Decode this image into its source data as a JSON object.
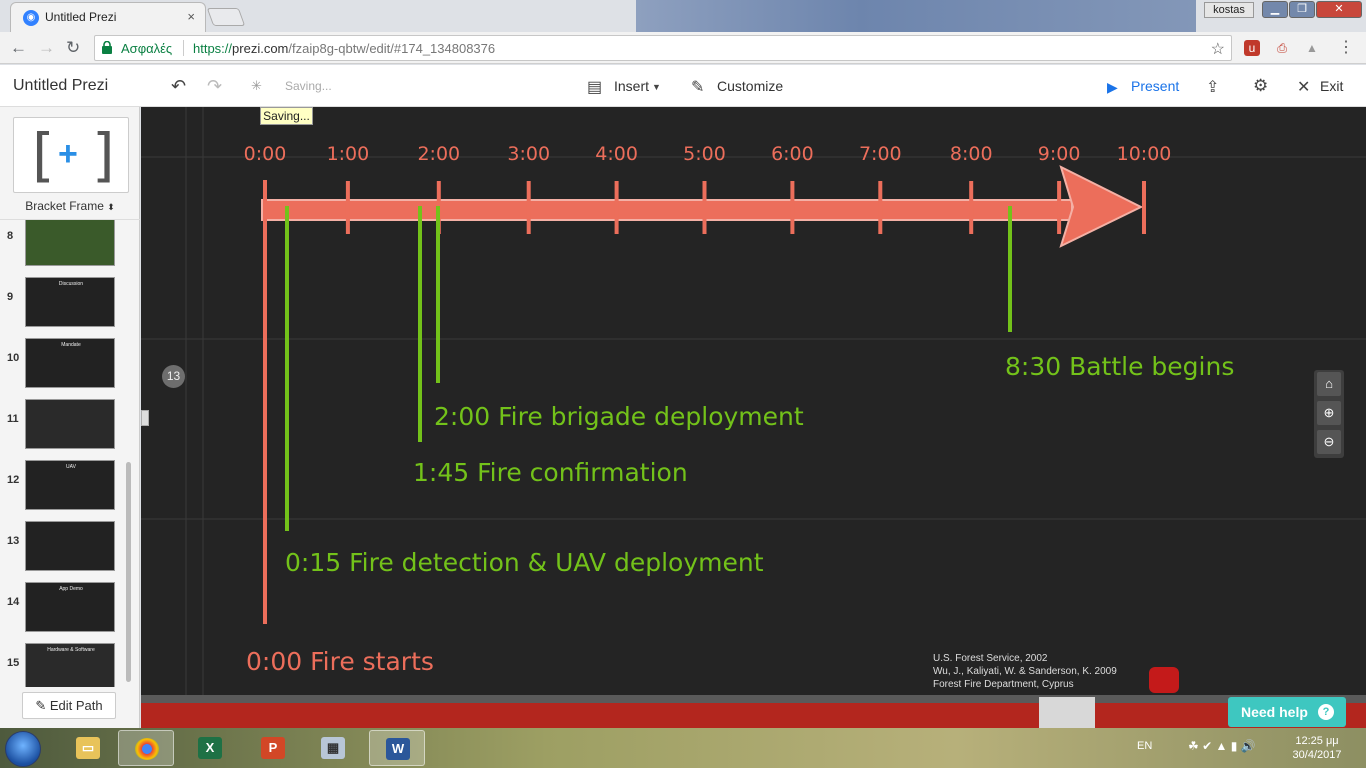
{
  "browser": {
    "tab_title": "Untitled Prezi",
    "tab_close": "×",
    "user_name": "kostas",
    "secure_label": "Ασφαλές",
    "url_proto": "https://",
    "url_host": "prezi.com",
    "url_path": "/fzaip8g-qbtw/edit/#174_134808376"
  },
  "toolbar": {
    "title": "Untitled Prezi",
    "saving": "Saving...",
    "insert": "Insert",
    "customize": "Customize",
    "present": "Present",
    "exit": "Exit"
  },
  "saving_tooltip": "Saving...",
  "sidebar": {
    "frame_type": "Bracket Frame",
    "edit_path": "Edit Path",
    "slides": [
      {
        "num": "8",
        "title": ""
      },
      {
        "num": "9",
        "title": "Discussion"
      },
      {
        "num": "10",
        "title": "Mandate"
      },
      {
        "num": "11",
        "title": ""
      },
      {
        "num": "12",
        "title": "UAV"
      },
      {
        "num": "13",
        "title": ""
      },
      {
        "num": "14",
        "title": "App Demo"
      },
      {
        "num": "15",
        "title": "Hardware & Software"
      }
    ]
  },
  "step_badge": "13",
  "timeline": {
    "ticks": [
      "0:00",
      "1:00",
      "2:00",
      "3:00",
      "4:00",
      "5:00",
      "6:00",
      "7:00",
      "8:00",
      "9:00",
      "10:00"
    ],
    "events": [
      {
        "label": "0:00 Fire starts",
        "color": "#ec6e5b"
      },
      {
        "label": "0:15 Fire detection & UAV deployment",
        "color": "#73c21a"
      },
      {
        "label": "1:45 Fire confirmation",
        "color": "#73c21a"
      },
      {
        "label": "2:00 Fire brigade deployment",
        "color": "#73c21a"
      },
      {
        "label": "8:30 Battle begins",
        "color": "#73c21a"
      }
    ],
    "credits": [
      "U.S. Forest Service, 2002",
      "Wu, J., Kaliyati, W. & Sanderson, K. 2009",
      "Forest Fire Department, Cyprus"
    ]
  },
  "help": {
    "label": "Need help",
    "icon": "?"
  },
  "taskbar": {
    "lang": "EN",
    "time": "12:25 μμ",
    "date": "30/4/2017"
  },
  "colors": {
    "canvas_bg": "#242424",
    "arrow": "#ec6e5b",
    "event_green": "#73c21a",
    "help": "#3ec7c0"
  }
}
